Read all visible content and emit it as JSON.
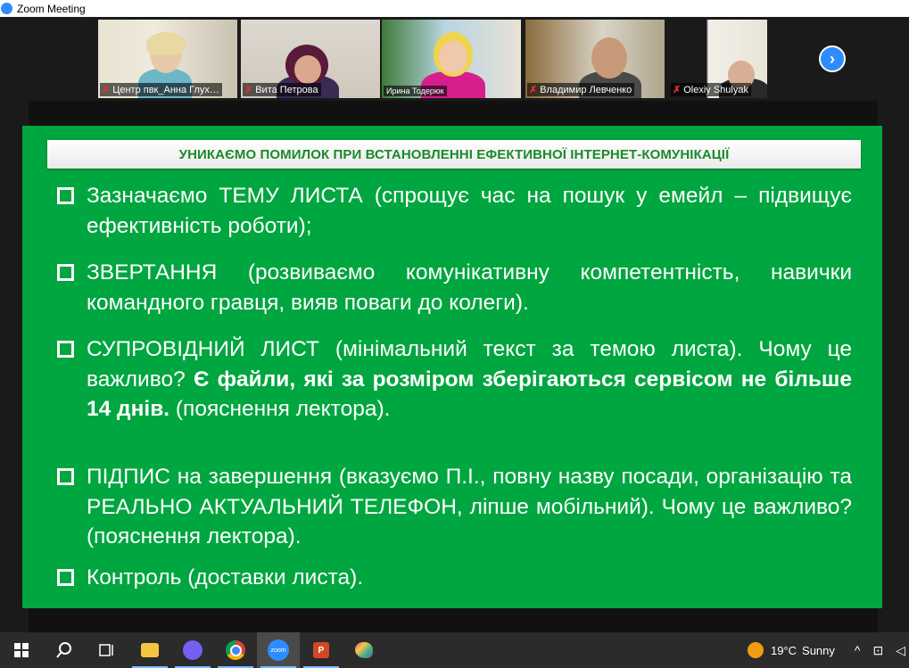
{
  "window": {
    "title": "Zoom Meeting"
  },
  "participants": [
    {
      "name": "Центр пвк_Анна Глух…",
      "muted": true
    },
    {
      "name": "Вита Петрова",
      "muted": true
    },
    {
      "name": "Ирина Тодерюк",
      "muted": false
    },
    {
      "name": "Владимир Левченко",
      "muted": true
    },
    {
      "name": "Olexiy Shulyak",
      "muted": true
    }
  ],
  "next_page": "›",
  "slide": {
    "heading": "УНИКАЄМО ПОМИЛОК ПРИ ВСТАНОВЛЕННІ ЕФЕКТИВНОЇ ІНТЕРНЕТ-КОМУНІКАЦІЇ",
    "bullets": [
      {
        "text": "Зазначаємо ТЕМУ ЛИСТА (спрощує час на пошук у емейл – підвищує ефективність роботи);"
      },
      {
        "text": "ЗВЕРТАННЯ (розвиваємо комунікативну компетентність, навички командного гравця, вияв поваги до колеги)."
      },
      {
        "text_before": "СУПРОВІДНИЙ ЛИСТ (мінімальний текст за темою листа). Чому це важливо? ",
        "bold": "Є файли, які за розміром зберігаються сервісом не більше 14 днів.",
        "text_after": " (пояснення лектора)."
      },
      {
        "text": "ПІДПИС на завершення (вказуємо П.І., повну назву посади, організацію та РЕАЛЬНО АКТУАЛЬНИЙ ТЕЛЕФОН, ліпше мобільний). Чому це важливо? (пояснення лектора)."
      },
      {
        "text": "Контроль (доставки листа)."
      }
    ]
  },
  "taskbar": {
    "weather": {
      "temp": "19°C",
      "condition": "Sunny"
    },
    "zoom_label": "zoom",
    "ppt_label": "P"
  },
  "colors": {
    "slide_bg": "#00a63f",
    "heading_text": "#1a8a2a",
    "zoom_blue": "#2d8cff"
  }
}
